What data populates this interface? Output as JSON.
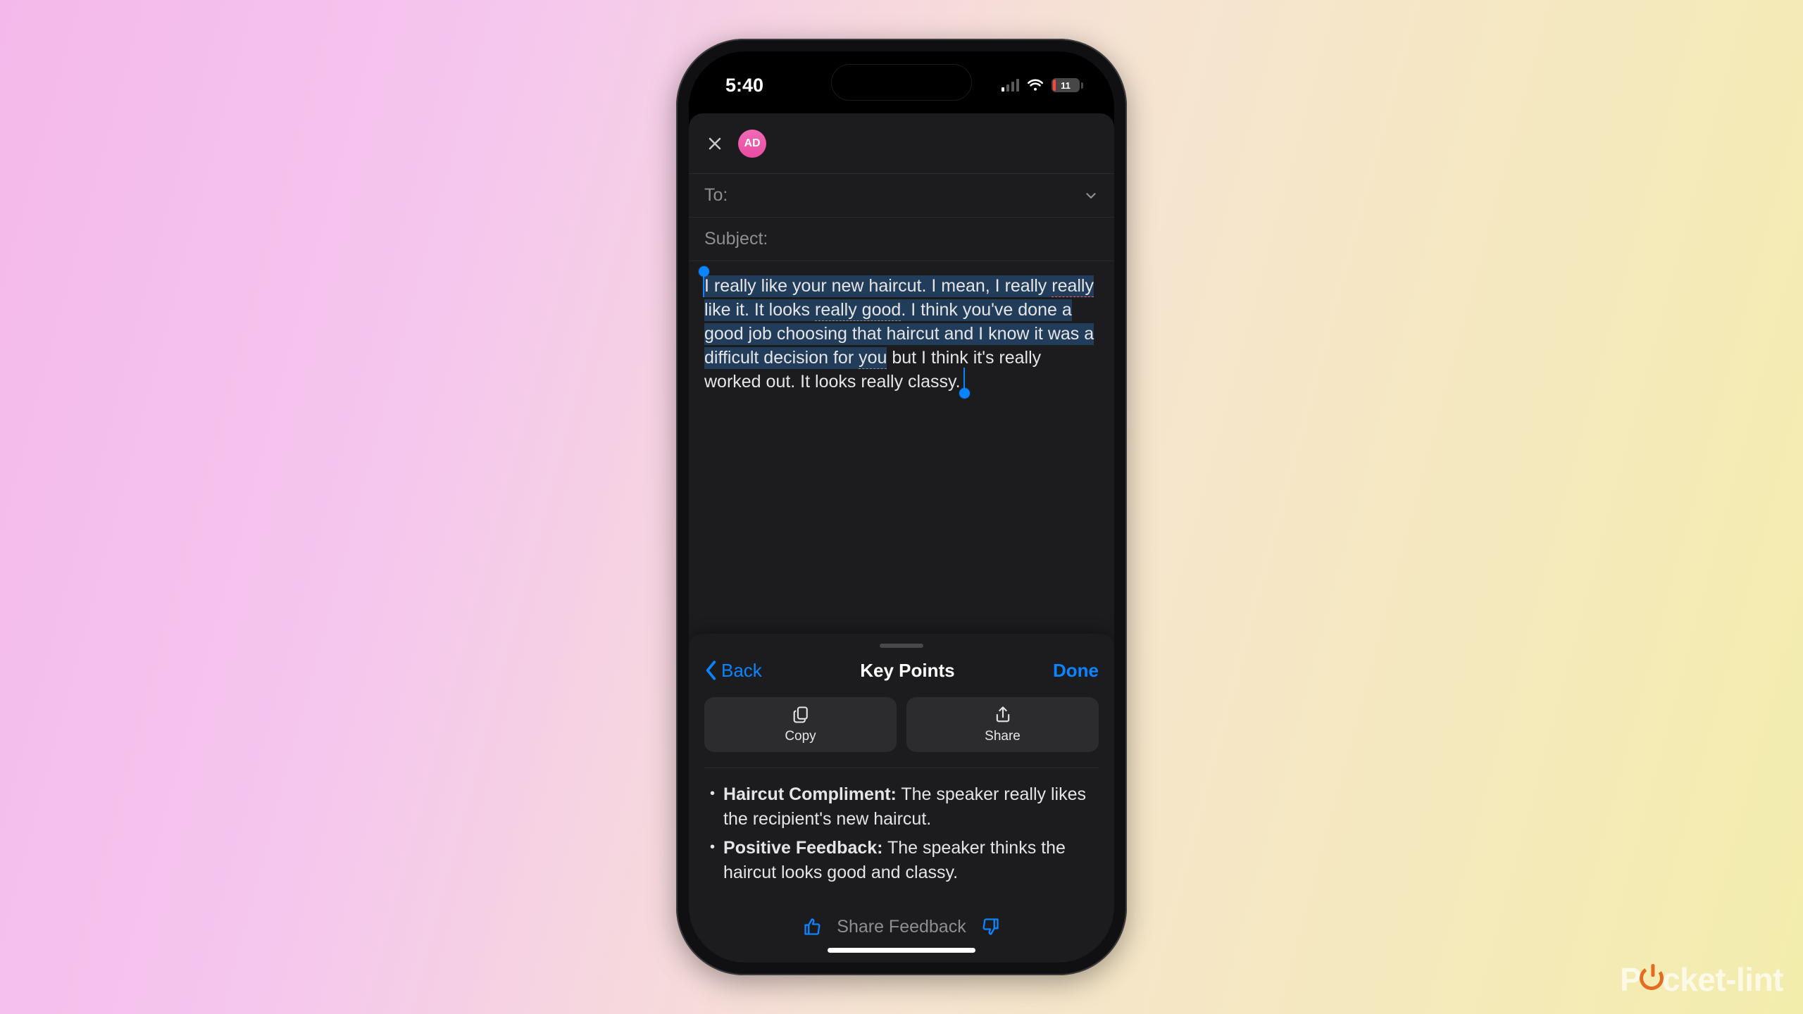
{
  "watermark": {
    "brand_left": "P",
    "brand_right": "cket-lint"
  },
  "status": {
    "time": "5:40",
    "battery_pct": "11",
    "signal_bars_active": 1
  },
  "compose": {
    "avatar_initials": "AD",
    "to_label": "To:",
    "subject_label": "Subject:",
    "body_segments": [
      {
        "text": "I really like your new haircut. I mean, I really ",
        "hl": true
      },
      {
        "text": "really",
        "hl": true,
        "red": true
      },
      {
        "text": " like it. It looks ",
        "hl": true
      },
      {
        "text": "really good",
        "hl": true,
        "u": true
      },
      {
        "text": ". I think you've done a good job choosing that haircut and I know it was a difficult decision for ",
        "hl": true
      },
      {
        "text": "you",
        "hl": true,
        "u": true
      },
      {
        "text": " but I think it's really worked out. It looks ",
        "hl": false
      },
      {
        "text": "really classy",
        "hl": false,
        "u": true
      },
      {
        "text": ".",
        "hl": false
      }
    ]
  },
  "sheet": {
    "back_label": "Back",
    "title": "Key Points",
    "done_label": "Done",
    "copy_label": "Copy",
    "share_label": "Share",
    "points": [
      {
        "title": "Haircut Compliment:",
        "text": " The speaker really likes the recipient's new haircut."
      },
      {
        "title": "Positive Feedback:",
        "text": " The speaker thinks the haircut looks good and classy."
      }
    ],
    "feedback_label": "Share Feedback"
  }
}
